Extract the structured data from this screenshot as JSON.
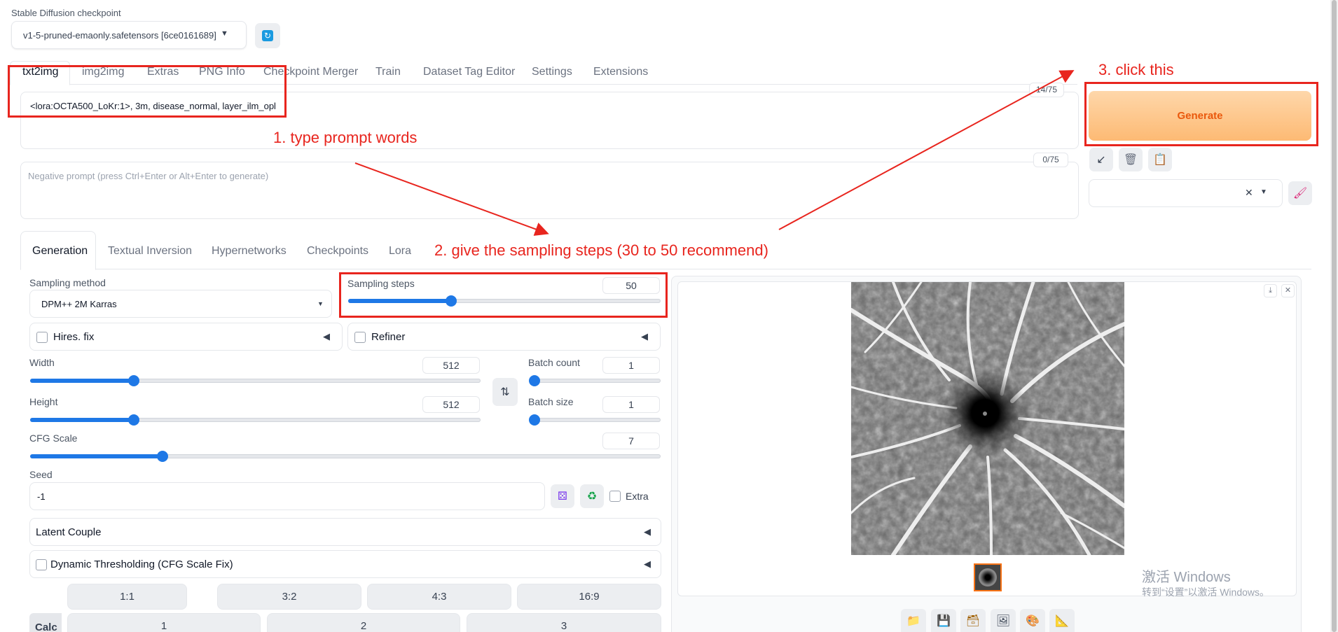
{
  "checkpoint": {
    "label": "Stable Diffusion checkpoint",
    "value": "v1-5-pruned-emaonly.safetensors [6ce0161689]"
  },
  "main_tabs": [
    "txt2img",
    "img2img",
    "Extras",
    "PNG Info",
    "Checkpoint Merger",
    "Train",
    "Dataset Tag Editor",
    "Settings",
    "Extensions"
  ],
  "prompt": {
    "value": "<lora:OCTA500_LoKr:1>, 3m, disease_normal, layer_ilm_opl",
    "token_count": "14/75"
  },
  "negative_prompt": {
    "placeholder": "Negative prompt (press Ctrl+Enter or Alt+Enter to generate)",
    "token_count": "0/75"
  },
  "generate_label": "Generate",
  "sub_tabs": [
    "Generation",
    "Textual Inversion",
    "Hypernetworks",
    "Checkpoints",
    "Lora"
  ],
  "sampling": {
    "method_label": "Sampling method",
    "method_value": "DPM++ 2M Karras",
    "steps_label": "Sampling steps",
    "steps_value": "50"
  },
  "hires_label": "Hires. fix",
  "refiner_label": "Refiner",
  "width": {
    "label": "Width",
    "value": "512"
  },
  "height": {
    "label": "Height",
    "value": "512"
  },
  "batch_count": {
    "label": "Batch count",
    "value": "1"
  },
  "batch_size": {
    "label": "Batch size",
    "value": "1"
  },
  "cfg": {
    "label": "CFG Scale",
    "value": "7"
  },
  "seed": {
    "label": "Seed",
    "value": "-1",
    "extra_label": "Extra"
  },
  "latent_couple_label": "Latent Couple",
  "dynamic_threshold_label": "Dynamic Thresholding (CFG Scale Fix)",
  "ratios": [
    "1:1",
    "3:2",
    "4:3",
    "16:9"
  ],
  "calc": {
    "label": "Calc",
    "buttons": [
      "1",
      "2",
      "3"
    ]
  },
  "annotations": {
    "a1": "1. type prompt words",
    "a2": "2. give the sampling steps (30 to 50 recommend)",
    "a3": "3. click this"
  },
  "watermark": {
    "line1": "激活 Windows",
    "line2": "转到“设置”以激活 Windows。"
  },
  "slider_levels": {
    "sampling_steps": 0.33,
    "width": 0.23,
    "height": 0.23,
    "batch_count": 0.0,
    "batch_size": 0.0,
    "cfg": 0.21
  },
  "colors": {
    "accent": "#1e78e6",
    "generate_text": "#ea580c",
    "annotation": "#e8251e"
  },
  "icons": [
    "refresh-icon",
    "swap-icon",
    "dice-icon",
    "recycle-icon",
    "arrow-icon",
    "trash-icon",
    "clipboard-icon",
    "brush-icon",
    "folder-icon",
    "save-icon",
    "zip-icon",
    "image-icon",
    "palette-icon",
    "ruler-icon",
    "download-icon",
    "close-icon"
  ]
}
